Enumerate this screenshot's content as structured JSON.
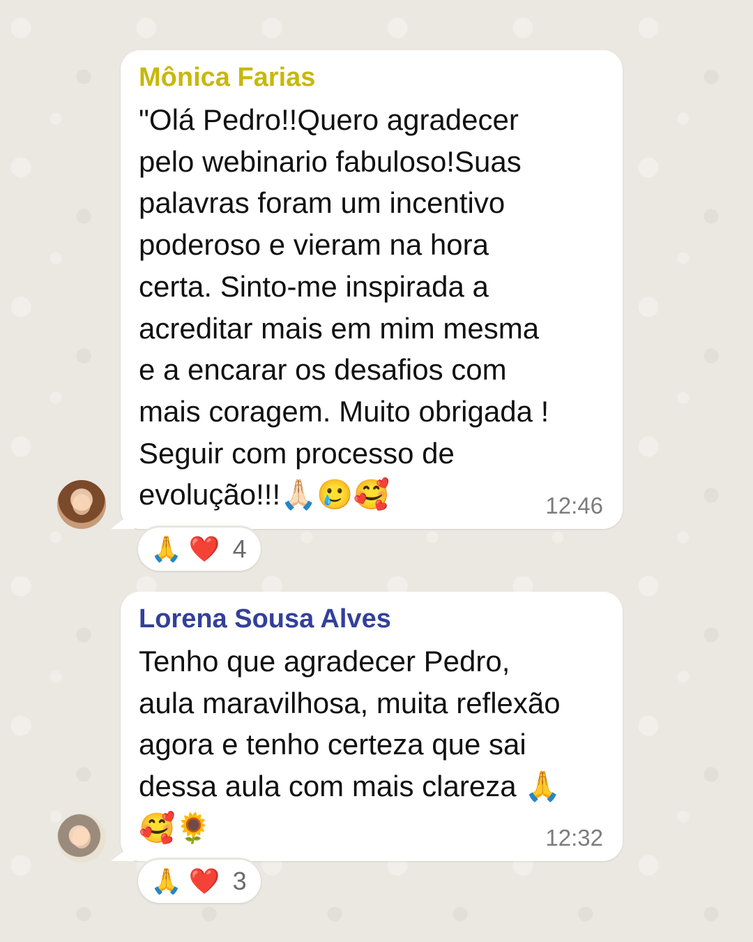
{
  "messages": [
    {
      "sender": "Mônica Farias",
      "text": "\"Olá Pedro!!Quero agradecer\npelo webinario fabuloso!Suas\npalavras foram um incentivo\npoderoso e vieram na hora\ncerta. Sinto-me inspirada a\nacreditar mais em mim mesma\ne a encarar os desafios com\nmais coragem. Muito obrigada !\nSeguir com processo de\nevolução!!!🙏🏻🥲🥰",
      "time": "12:46",
      "reactions": {
        "emoji_1": "🙏",
        "emoji_2": "❤️",
        "count": "4"
      }
    },
    {
      "sender": "Lorena Sousa Alves",
      "text": "Tenho que agradecer Pedro,\naula maravilhosa, muita reflexão\nagora e tenho certeza que sai\ndessa aula com mais clareza 🙏\n🥰🌻",
      "time": "12:32",
      "reactions": {
        "emoji_1": "🙏",
        "emoji_2": "❤️",
        "count": "3"
      }
    }
  ],
  "colors": {
    "background": "#ebe7e1",
    "bubble": "#ffffff",
    "sender_1": "#c7b80c",
    "sender_2": "#33409a",
    "timestamp": "#7c7c7c"
  }
}
